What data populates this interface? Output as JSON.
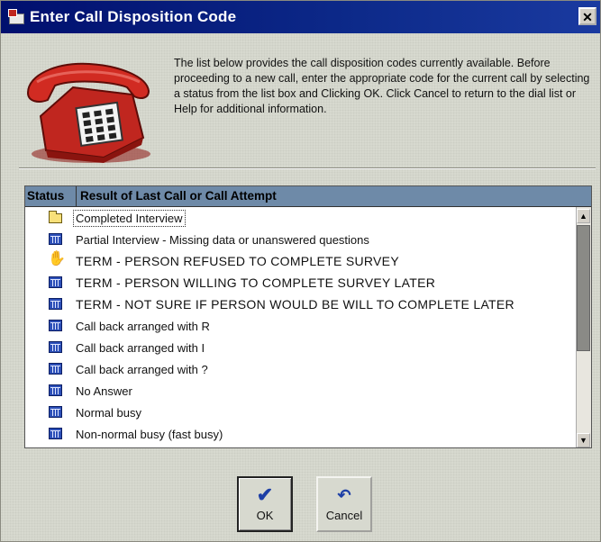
{
  "window": {
    "title": "Enter Call Disposition Code",
    "close_label": "✕"
  },
  "instructions": "The list below provides the call disposition codes currently available. Before proceeding to a new call, enter the appropriate code for the current call by selecting a status from the list box and Clicking OK. Click Cancel to return to the dial list or Help for additional information.",
  "list": {
    "headers": {
      "status": "Status",
      "result": "Result of Last Call or Call Attempt"
    },
    "items": [
      {
        "icon": "folder-icon",
        "label": "Completed Interview",
        "selected": true
      },
      {
        "icon": "calendar-icon",
        "label": "Partial Interview - Missing data or unanswered questions"
      },
      {
        "icon": "hand-icon",
        "label": "TERM - PERSON REFUSED TO COMPLETE SURVEY"
      },
      {
        "icon": "calendar-icon",
        "label": "TERM - PERSON WILLING TO COMPLETE SURVEY LATER"
      },
      {
        "icon": "calendar-icon",
        "label": "TERM - NOT SURE IF PERSON WOULD BE WILL TO COMPLETE LATER"
      },
      {
        "icon": "calendar-icon",
        "label": "Call back arranged with R"
      },
      {
        "icon": "calendar-icon",
        "label": "Call back arranged with I"
      },
      {
        "icon": "calendar-icon",
        "label": "Call back arranged with ?"
      },
      {
        "icon": "calendar-icon",
        "label": "No Answer"
      },
      {
        "icon": "calendar-icon",
        "label": "Normal busy"
      },
      {
        "icon": "calendar-icon",
        "label": "Non-normal busy (fast busy)"
      }
    ]
  },
  "buttons": {
    "ok_label": "OK",
    "cancel_label": "Cancel"
  },
  "colors": {
    "title_bar": "#0d2a8a",
    "list_header": "#6e8aa8",
    "phone": "#c0261f"
  }
}
